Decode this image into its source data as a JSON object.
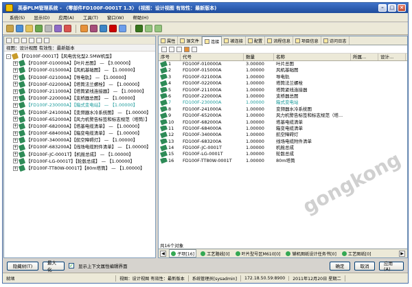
{
  "window": {
    "title": "英泰PLM管理系统 - 〈零部件FD100F-0001T 1.3〉 (视图：设计视图 有效性：最新版本)"
  },
  "menu": [
    "系统(S)",
    "显示(D)",
    "应用(A)",
    "工具(T)",
    "窗口(W)",
    "帮助(H)"
  ],
  "left": {
    "view_line": "视图：设计视图 有效性：最新版本",
    "root": "【FD100F-0001T】【风电优化型2.5MW机型】",
    "items": [
      "【FD100F-010000A】【叶片总图】 — 【3.00000】",
      "【FD100F-015000A】【风机基础图】 — 【1.00000】",
      "【FD100F-021000A】【导电轨】 — 【1.00000】",
      "【FD100F-022000A】【塔筒法兰螺栓】 — 【1.00000】",
      "【FD100F-211000A】【塔筒紧线连接器】 — 【1.00000】",
      "【FD100F-220000A】【支桥器总图】 — 【1.00000】",
      "【FD100F-230000A】【箱式变电站】 — 【1.00000】",
      "【FD100F-241000A】【变频器水冷系统图】 — 【1.00000】",
      "【FD100F-652000A】【风力机警告标签和标志规范（塔筒）】",
      "【FD100F-682000A】【塔基电缆清单】 — 【1.00000】",
      "【FD100F-684000A】【箱变电缆清单】 — 【1.00000】",
      "【FD100F-340000A】【航空障碍灯】 — 【1.00000】",
      "【FD100F-683200A】【线场电缆附件清单】 — 【1.00000】",
      "【FD100F-JC-0001T】【机舱总成】 — 【1.00000】",
      "【FD100F-LG-0001T】【轮毂总成】 — 【1.00000】",
      "【FD100F-TT80W-0001T】【80m塔筒】 — 【1.00000】"
    ],
    "selected_index": 6
  },
  "tabs": [
    "属性",
    "源文件",
    "连接",
    "被连接",
    "配置",
    "流程信息",
    "项目信息",
    "访问日志"
  ],
  "active_tab": 2,
  "table": {
    "headers": [
      "序号",
      "代号",
      "数量",
      "名称",
      "所属...",
      "设计..."
    ],
    "rows": [
      [
        "1",
        "FD100F-010000A",
        "3.00000",
        "叶片总图"
      ],
      [
        "2",
        "FD100F-015000A",
        "1.00000",
        "风机基础图"
      ],
      [
        "3",
        "FD100F-021000A",
        "1.00000",
        "导电轨"
      ],
      [
        "4",
        "FD100F-022000A",
        "1.00000",
        "塔筒法兰螺栓"
      ],
      [
        "5",
        "FD100F-211000A",
        "1.00000",
        "塔筒紧线连接器"
      ],
      [
        "6",
        "FD100F-220000A",
        "1.00000",
        "支桥器总图"
      ],
      [
        "7",
        "FD100F-230000A",
        "1.00000",
        "箱式变电站"
      ],
      [
        "8",
        "FD100F-241000A",
        "1.00000",
        "变频器水冷系统图"
      ],
      [
        "9",
        "FD100F-652000A",
        "1.00000",
        "风力机警告标签和标志规范（塔..."
      ],
      [
        "10",
        "FD100F-682000A",
        "1.00000",
        "塔基电缆清单"
      ],
      [
        "11",
        "FD100F-684000A",
        "1.00000",
        "箱变电缆清单"
      ],
      [
        "12",
        "FD100F-340000A",
        "1.00000",
        "航空障碍灯"
      ],
      [
        "13",
        "FD100F-683200A",
        "1.00000",
        "线场电缆附件清单"
      ],
      [
        "14",
        "FD100F-JC-0001T",
        "1.00000",
        "机舱总成"
      ],
      [
        "15",
        "FD100F-LG-0001T",
        "1.00000",
        "轮毂总成"
      ],
      [
        "16",
        "FD100F-TT80W-0001T",
        "1.00000",
        "80m塔筒"
      ]
    ],
    "selected_index": 6,
    "count_text": "共16个对象"
  },
  "bottom_tabs": [
    "子项[16]",
    "工艺路线[0]",
    "叶片型号区M610[0]",
    "辅机图纸设计任务书[0]",
    "工艺图纸[0]"
  ],
  "buttons": {
    "hide_tree": "隐藏树(T)",
    "maximize": "最大化",
    "show_updown": "显示上下文属性编辑界面",
    "ok": "确定",
    "cancel": "取消",
    "apply": "应用(A)"
  },
  "status": {
    "ready": "就绪",
    "view": "视图：设计视图 有效性：最新版本",
    "user": "系统管理员[sysadmin]",
    "ip": "172.18.50.59:8900",
    "date": "2011年12月20日 星期二"
  },
  "watermark": "gongkong"
}
